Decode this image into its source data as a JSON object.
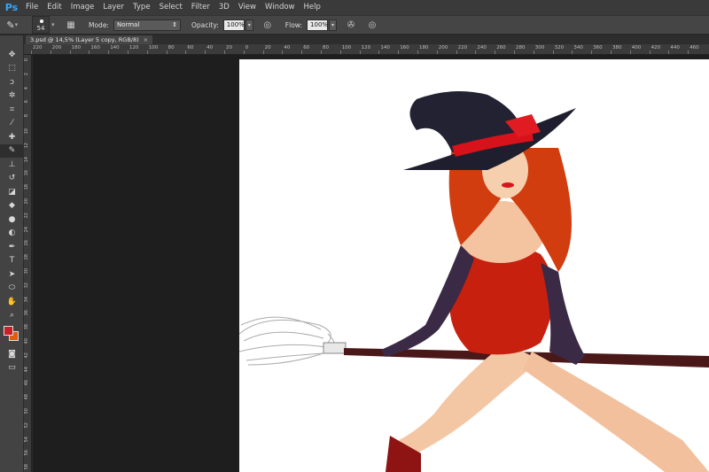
{
  "app": {
    "logo": "Ps"
  },
  "menu": [
    "File",
    "Edit",
    "Image",
    "Layer",
    "Type",
    "Select",
    "Filter",
    "3D",
    "View",
    "Window",
    "Help"
  ],
  "options": {
    "brush_size": "54",
    "mode_label": "Mode:",
    "mode_value": "Normal",
    "opacity_label": "Opacity:",
    "opacity_value": "100%",
    "flow_label": "Flow:",
    "flow_value": "100%"
  },
  "document": {
    "tab_title": "3.psd @ 14,5% (Layer 5 copy, RGB/8)",
    "close": "×"
  },
  "ruler": {
    "h_labels": [
      "220",
      "200",
      "180",
      "160",
      "140",
      "120",
      "100",
      "80",
      "60",
      "40",
      "20",
      "0",
      "20",
      "40",
      "60",
      "80",
      "100",
      "120",
      "140",
      "160",
      "180",
      "200",
      "220",
      "240",
      "260",
      "280",
      "300",
      "320",
      "340",
      "360",
      "380",
      "400",
      "420",
      "440",
      "460"
    ],
    "v_labels": [
      "0",
      "2",
      "4",
      "6",
      "8",
      "10",
      "12",
      "14",
      "16",
      "18",
      "20",
      "22",
      "24",
      "26",
      "28",
      "30",
      "32",
      "34",
      "36",
      "38",
      "40",
      "42",
      "44",
      "46",
      "48",
      "50",
      "52",
      "54",
      "56",
      "58"
    ]
  },
  "tools": [
    "move-icon",
    "marquee-icon",
    "lasso-icon",
    "magic-wand-icon",
    "crop-icon",
    "eyedropper-icon",
    "healing-icon",
    "brush-icon",
    "stamp-icon",
    "history-brush-icon",
    "eraser-icon",
    "bucket-icon",
    "blur-icon",
    "dodge-icon",
    "pen-icon",
    "type-icon",
    "path-select-icon",
    "shape-icon",
    "hand-icon",
    "zoom-icon"
  ],
  "colors": {
    "foreground": "#cc1e26",
    "background": "#e05a10"
  }
}
